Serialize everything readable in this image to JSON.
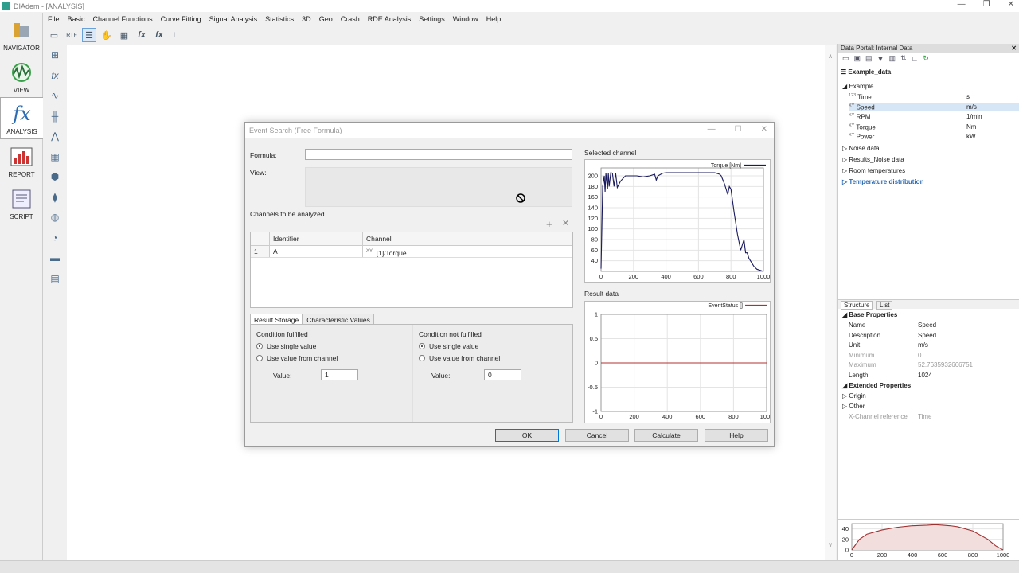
{
  "window": {
    "title": "DIAdem - [ANALYSIS]",
    "controls": [
      "—",
      "❐",
      "✕"
    ]
  },
  "menu": [
    "File",
    "Basic",
    "Channel Functions",
    "Curve Fitting",
    "Signal Analysis",
    "Statistics",
    "3D",
    "Geo",
    "Crash",
    "RDE Analysis",
    "Settings",
    "Window",
    "Help"
  ],
  "nav": [
    {
      "label": "NAVIGATOR",
      "icon": "navigator-icon"
    },
    {
      "label": "VIEW",
      "icon": "view-icon"
    },
    {
      "label": "ANALYSIS",
      "icon": "analysis-fx-icon"
    },
    {
      "label": "REPORT",
      "icon": "report-icon"
    },
    {
      "label": "SCRIPT",
      "icon": "script-icon"
    }
  ],
  "dialog": {
    "title": "Event Search (Free Formula)",
    "formula_label": "Formula:",
    "formula_value": "",
    "view_label": "View:",
    "channels_label": "Channels to be analyzed",
    "grid": {
      "headers": [
        "",
        "Identifier",
        "Channel"
      ],
      "rows": [
        {
          "num": "1",
          "identifier": "A",
          "channel_prefix": "XY",
          "channel": "[1]/Torque"
        }
      ]
    },
    "tabs": [
      "Result Storage",
      "Characteristic Values"
    ],
    "fulfilled": {
      "heading": "Condition fulfilled",
      "opt1": "Use single value",
      "opt2": "Use value from channel",
      "value_label": "Value:",
      "value": "1"
    },
    "not_fulfilled": {
      "heading": "Condition not fulfilled",
      "opt1": "Use single value",
      "opt2": "Use value from channel",
      "value_label": "Value:",
      "value": "0"
    },
    "selected_channel_label": "Selected channel",
    "result_data_label": "Result data",
    "buttons": {
      "ok": "OK",
      "cancel": "Cancel",
      "calculate": "Calculate",
      "help": "Help"
    }
  },
  "portal": {
    "title": "Data Portal: Internal Data",
    "file": "Example_data",
    "group": "Example",
    "channels": [
      {
        "prefix": "123",
        "name": "Time",
        "unit": "s"
      },
      {
        "prefix": "XY",
        "name": "Speed",
        "unit": "m/s"
      },
      {
        "prefix": "XY",
        "name": "RPM",
        "unit": "1/min"
      },
      {
        "prefix": "XY",
        "name": "Torque",
        "unit": "Nm"
      },
      {
        "prefix": "XY",
        "name": "Power",
        "unit": "kW"
      }
    ],
    "groups": [
      "Noise data",
      "Results_Noise data",
      "Room temperatures",
      "Temperature distribution"
    ],
    "tabs": [
      "Structure",
      "List"
    ],
    "base_heading": "Base Properties",
    "props": [
      {
        "k": "Name",
        "v": "Speed",
        "grey": false
      },
      {
        "k": "Description",
        "v": "Speed",
        "grey": false
      },
      {
        "k": "Unit",
        "v": "m/s",
        "grey": false
      },
      {
        "k": "Minimum",
        "v": "0",
        "grey": true
      },
      {
        "k": "Maximum",
        "v": "52.7635932666751",
        "grey": true
      },
      {
        "k": "Length",
        "v": "1024",
        "grey": false
      }
    ],
    "ext_heading": "Extended Properties",
    "ext": [
      "Origin",
      "Other"
    ],
    "xref": {
      "k": "X-Channel reference",
      "v": "Time"
    }
  },
  "chart_data": [
    {
      "type": "line",
      "legend": "Torque [Nm]",
      "xlim": [
        0,
        1000
      ],
      "ylim": [
        20,
        215
      ],
      "xticks": [
        0,
        200,
        400,
        600,
        800,
        1000
      ],
      "yticks": [
        40,
        60,
        80,
        100,
        120,
        140,
        160,
        180,
        200
      ],
      "color": "#1a1a5e",
      "x": [
        0,
        5,
        10,
        20,
        25,
        30,
        40,
        45,
        50,
        60,
        70,
        80,
        90,
        100,
        120,
        150,
        180,
        220,
        260,
        300,
        330,
        340,
        350,
        380,
        400,
        450,
        500,
        550,
        600,
        650,
        700,
        730,
        740,
        760,
        780,
        790,
        800,
        820,
        840,
        860,
        880,
        890,
        900,
        910,
        920,
        940,
        960,
        980,
        1000
      ],
      "y": [
        25,
        100,
        180,
        200,
        170,
        205,
        175,
        205,
        180,
        206,
        205,
        180,
        205,
        178,
        190,
        200,
        200,
        200,
        198,
        200,
        203,
        192,
        200,
        205,
        206,
        206,
        206,
        206,
        206,
        206,
        206,
        203,
        200,
        185,
        165,
        180,
        175,
        130,
        90,
        60,
        80,
        55,
        55,
        45,
        40,
        30,
        24,
        22,
        20
      ]
    },
    {
      "type": "line",
      "legend": "EventStatus []",
      "xlim": [
        0,
        1000
      ],
      "ylim": [
        -1,
        1
      ],
      "xticks": [
        0,
        200,
        400,
        600,
        800,
        1000
      ],
      "yticks": [
        -1,
        -0.5,
        0,
        0.5,
        1
      ],
      "color": "#b03030",
      "x": [
        0,
        1000
      ],
      "y": [
        0,
        0
      ]
    },
    {
      "type": "area",
      "xlim": [
        0,
        1000
      ],
      "ylim": [
        0,
        50
      ],
      "xticks": [
        0,
        200,
        400,
        600,
        800,
        1000
      ],
      "yticks": [
        0,
        20,
        40
      ],
      "color": "#a03030",
      "x": [
        0,
        50,
        100,
        200,
        300,
        400,
        500,
        550,
        600,
        650,
        700,
        800,
        900,
        950,
        1000
      ],
      "y": [
        0,
        20,
        30,
        38,
        43,
        46,
        47,
        48,
        47,
        46,
        44,
        36,
        20,
        8,
        0
      ]
    }
  ]
}
